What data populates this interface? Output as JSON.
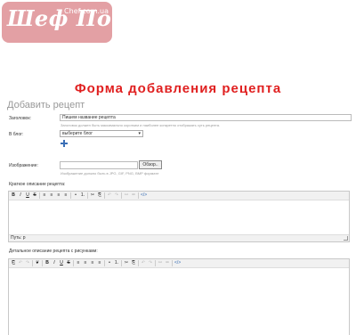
{
  "logo": {
    "name": "Шеф Повар",
    "domain": "Chef.com.ua"
  },
  "form": {
    "title": "Форма добавления рецепта",
    "section": "Добавить рецепт",
    "title_label": "Заголовок:",
    "title_value": "Пишем название рецепта",
    "title_hint": "Заголовок должен быть максимально коротким и наиболее конкретно отображать суть рецепта.",
    "blog_label": "В блог:",
    "blog_value": "выберите блог",
    "image_label": "Изображение:",
    "browse_label": "Обзор..",
    "image_hint": "Изображение должно быть в JPG, GIF, PNG, BMP формате",
    "short_label": "Краткое описание рецепта:",
    "short_path": "Путь: p",
    "detail_label": "Детальное описание рецепта с рисунками:"
  },
  "toolbar_short": {
    "buttons": [
      "B",
      "I",
      "U",
      "S",
      "|",
      "≡",
      "≡",
      "≡",
      "≡",
      "|",
      "•",
      "1.",
      "|",
      "✂",
      "⎘",
      "|",
      "↶",
      "↷",
      "|",
      "⚯",
      "⚮",
      "|",
      "</>"
    ]
  },
  "toolbar_detail": {
    "buttons": [
      "⎗",
      "↶",
      "↷",
      "|",
      "❦",
      "|",
      "B",
      "I",
      "U",
      "S",
      "|",
      "≡",
      "≡",
      "≡",
      "≡",
      "|",
      "•",
      "1.",
      "|",
      "✂",
      "⎘",
      "|",
      "↶",
      "↷",
      "|",
      "⚯",
      "⚮",
      "|",
      "</>"
    ]
  },
  "colors": {
    "logo_bg": "#e3a0a4",
    "title": "#e02020",
    "accent": "#3b6fb6"
  }
}
